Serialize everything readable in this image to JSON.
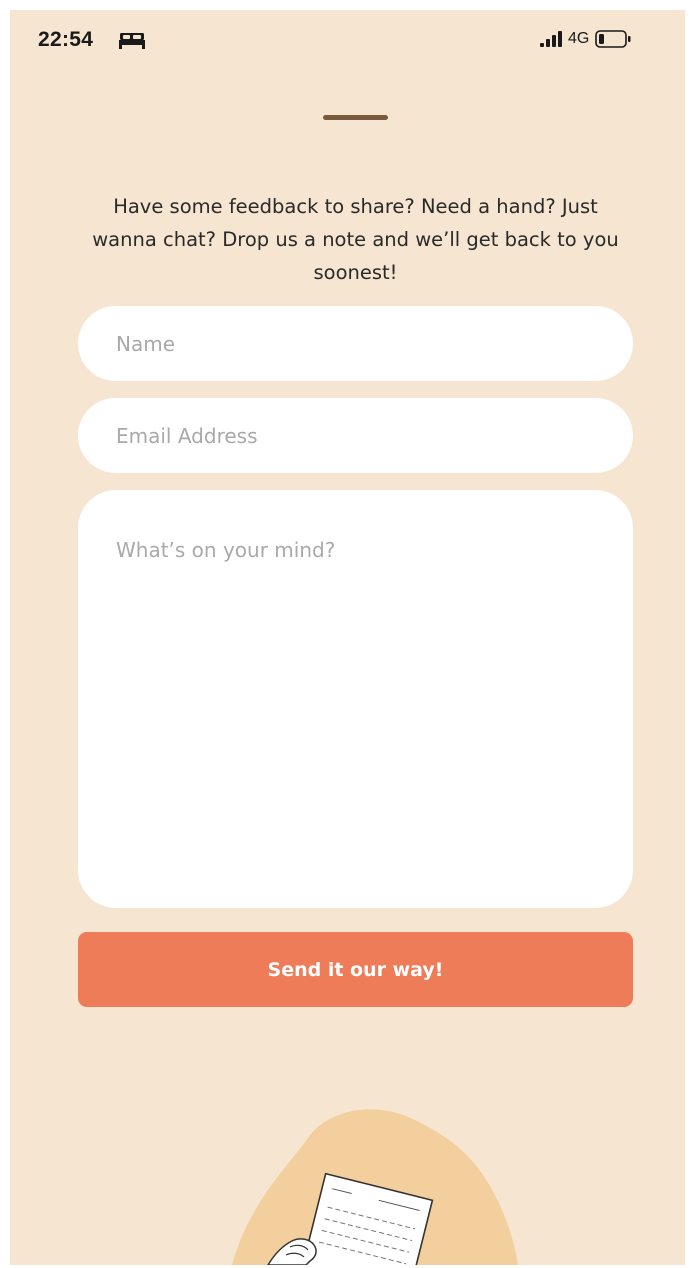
{
  "status_bar": {
    "time": "22:54",
    "sleep_icon": "bed-icon",
    "signal_icon": "cellular-signal-icon",
    "network": "4G",
    "battery_icon": "battery-low-icon",
    "battery_level": 0.2
  },
  "sheet": {
    "handle_icon": "drag-handle"
  },
  "intro": {
    "text": "Have some feedback to share? Need a hand? Just wanna chat? Drop us a note and we’ll get back to you soonest!"
  },
  "form": {
    "name": {
      "value": "",
      "placeholder": "Name"
    },
    "email": {
      "value": "",
      "placeholder": "Email Address"
    },
    "message": {
      "value": "",
      "placeholder": "What’s on your mind?"
    },
    "submit_label": "Send it our way!"
  },
  "illustration": {
    "icon": "letter-in-hand-illustration"
  },
  "colors": {
    "background": "#f5e5d1",
    "field_background": "#ffffff",
    "button": "#ee7c58",
    "button_text": "#ffffff",
    "handle": "#7a5a3e",
    "blob": "#f2cf9c"
  }
}
